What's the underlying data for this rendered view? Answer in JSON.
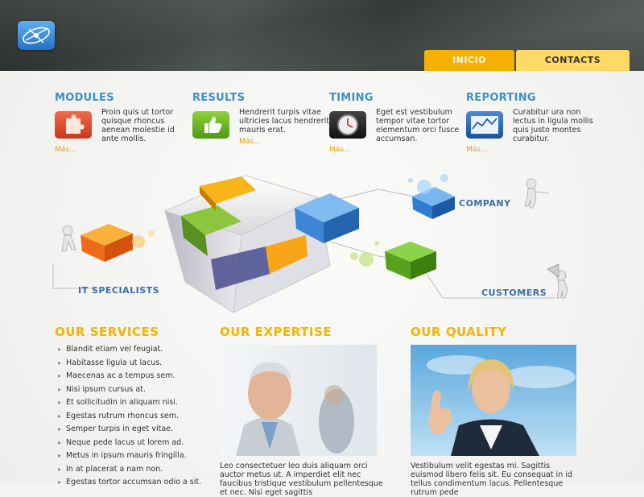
{
  "nav": {
    "tabs": [
      {
        "label": "INICIO"
      },
      {
        "label": "CONTACTS"
      }
    ]
  },
  "features": [
    {
      "title": "MODULES",
      "text": "Proin quis ut tortor quisque rhoncus aenean molestie id ante mollis.",
      "more": "Más...",
      "icon": "puzzle-icon"
    },
    {
      "title": "RESULTS",
      "text": "Hendrerit turpis vitae ultricies lacus hendrerit mauris erat.",
      "more": "Más...",
      "icon": "thumbs-up-icon"
    },
    {
      "title": "TIMING",
      "text": "Eget est vestibulum tempor vitae tortor elementum orci fusce accumsan.",
      "more": "Más...",
      "icon": "clock-icon"
    },
    {
      "title": "REPORTING",
      "text": "Curabitur ura non lectus in ligula mollis quis justo montes curabitur.",
      "more": "Más...",
      "icon": "chart-icon"
    }
  ],
  "diagram": {
    "company": "COMPANY",
    "it_specialists": "IT SPECIALISTS",
    "customers": "CUSTOMERS"
  },
  "services": {
    "title": "OUR SERVICES",
    "items": [
      "Blandit etiam vel feugiat.",
      "Habitasse ligula ut lacus.",
      "Maecenas ac a tempus sem.",
      "Nisi ipsum cursus at.",
      "Et sollicitudin in aliquam nisi.",
      "Egestas rutrum rhoncus sem.",
      "Semper turpis in eget vitae.",
      "Neque pede lacus ut lorem ad.",
      "Metus in ipsum mauris fringilla.",
      "In at placerat a nam non.",
      "Egestas tortor accumsan odio a sit."
    ]
  },
  "expertise": {
    "title": "OUR EXPERTISE",
    "caption": "Leo consectetuer leo duis aliquam orci auctor metus ut. A imperdiet elit nec faucibus tristique vestibulum pellentesque et nec. Nisi eget sagittis"
  },
  "quality": {
    "title": "OUR QUALITY",
    "caption": "Vestibulum velit egestas mi. Sagittis euismod libero felis sit. Eu consequat in id tellus condimentum lacus. Pellentesque rutrum pede"
  },
  "colors": {
    "accent": "#f5b400",
    "link_blue": "#3f8fc4",
    "header": "#3a3f3d"
  }
}
